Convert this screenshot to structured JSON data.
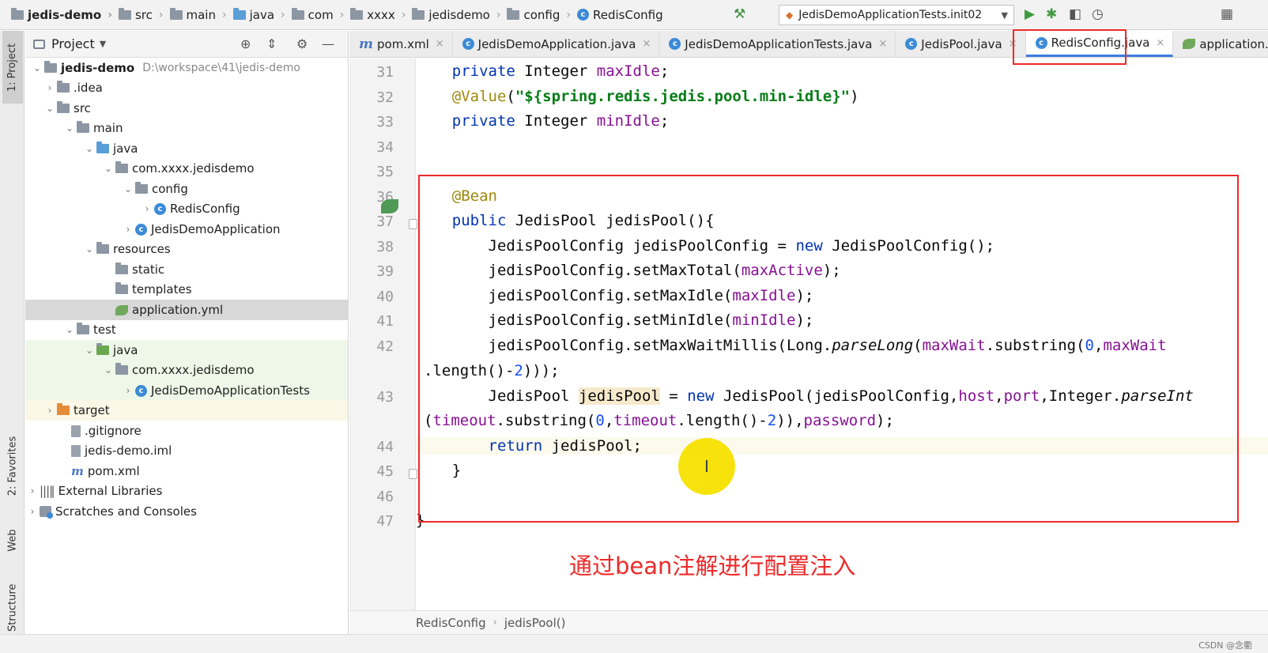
{
  "navbar": {
    "crumbs": [
      "jedis-demo",
      "src",
      "main",
      "java",
      "com",
      "xxxx",
      "jedisdemo",
      "config",
      "RedisConfig"
    ],
    "run_config": "JedisDemoApplicationTests.init02"
  },
  "tool_strip": {
    "project": "1: Project",
    "favorites": "2: Favorites",
    "web": "Web",
    "structure": "Z: Structure"
  },
  "project_panel": {
    "title": "Project",
    "root_name": "jedis-demo",
    "root_path": "D:\\workspace\\41\\jedis-demo",
    "items": [
      {
        "label": ".idea"
      },
      {
        "label": "src"
      },
      {
        "label": "main"
      },
      {
        "label": "java"
      },
      {
        "label": "com.xxxx.jedisdemo"
      },
      {
        "label": "config"
      },
      {
        "label": "RedisConfig"
      },
      {
        "label": "JedisDemoApplication"
      },
      {
        "label": "resources"
      },
      {
        "label": "static"
      },
      {
        "label": "templates"
      },
      {
        "label": "application.yml"
      },
      {
        "label": "test"
      },
      {
        "label": "java"
      },
      {
        "label": "com.xxxx.jedisdemo"
      },
      {
        "label": "JedisDemoApplicationTests"
      },
      {
        "label": "target"
      },
      {
        "label": ".gitignore"
      },
      {
        "label": "jedis-demo.iml"
      },
      {
        "label": "pom.xml"
      },
      {
        "label": "External Libraries"
      },
      {
        "label": "Scratches and Consoles"
      }
    ]
  },
  "tabs": [
    {
      "label": "pom.xml"
    },
    {
      "label": "JedisDemoApplication.java"
    },
    {
      "label": "JedisDemoApplicationTests.java"
    },
    {
      "label": "JedisPool.java"
    },
    {
      "label": "RedisConfig.java"
    },
    {
      "label": "application.ym"
    }
  ],
  "editor": {
    "line_numbers": [
      "31",
      "32",
      "33",
      "34",
      "35",
      "36",
      "37",
      "38",
      "39",
      "40",
      "41",
      "42",
      "43",
      "44",
      "45",
      "46",
      "47"
    ]
  },
  "annotation": {
    "caption": "通过bean注解进行配置注入",
    "color": "#ee2a2a"
  },
  "breadcrumb": {
    "class_name": "RedisConfig",
    "method_name": "jedisPool()"
  },
  "watermark": "CSDN @念衢",
  "colors": {
    "keyword": "#0033b3",
    "annotation": "#9e880d",
    "string": "#067d17",
    "field": "#871094",
    "number": "#1750eb",
    "active_tab": "#3d7ce0",
    "highlight_box": "#ee2a2a"
  }
}
